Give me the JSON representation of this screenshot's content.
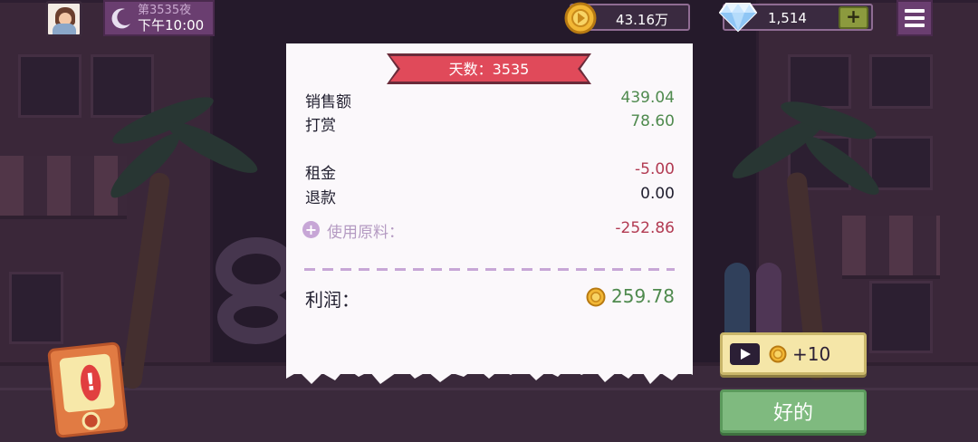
{
  "hud": {
    "night_label": "第3535夜",
    "time_label": "下午10:00",
    "coins": "43.16万",
    "gems": "1,514",
    "gem_add_label": "+"
  },
  "receipt": {
    "banner": "天数：3535",
    "rows": [
      {
        "label": "销售额",
        "value": "439.04"
      },
      {
        "label": "打赏",
        "value": "78.60"
      },
      {
        "label": "租金",
        "value": "-5.00"
      },
      {
        "label": "退款",
        "value": "0.00"
      }
    ],
    "materials_label": "使用原料：",
    "materials_value": "-252.86",
    "profit_label": "利润：",
    "profit_value": "259.78"
  },
  "buttons": {
    "ad_reward": "+10",
    "ok": "好的"
  },
  "colors": {
    "positive": "#4f8a4e",
    "negative": "#b23a52",
    "banner": "#e04a5a",
    "ok_button": "#7fba7f"
  }
}
